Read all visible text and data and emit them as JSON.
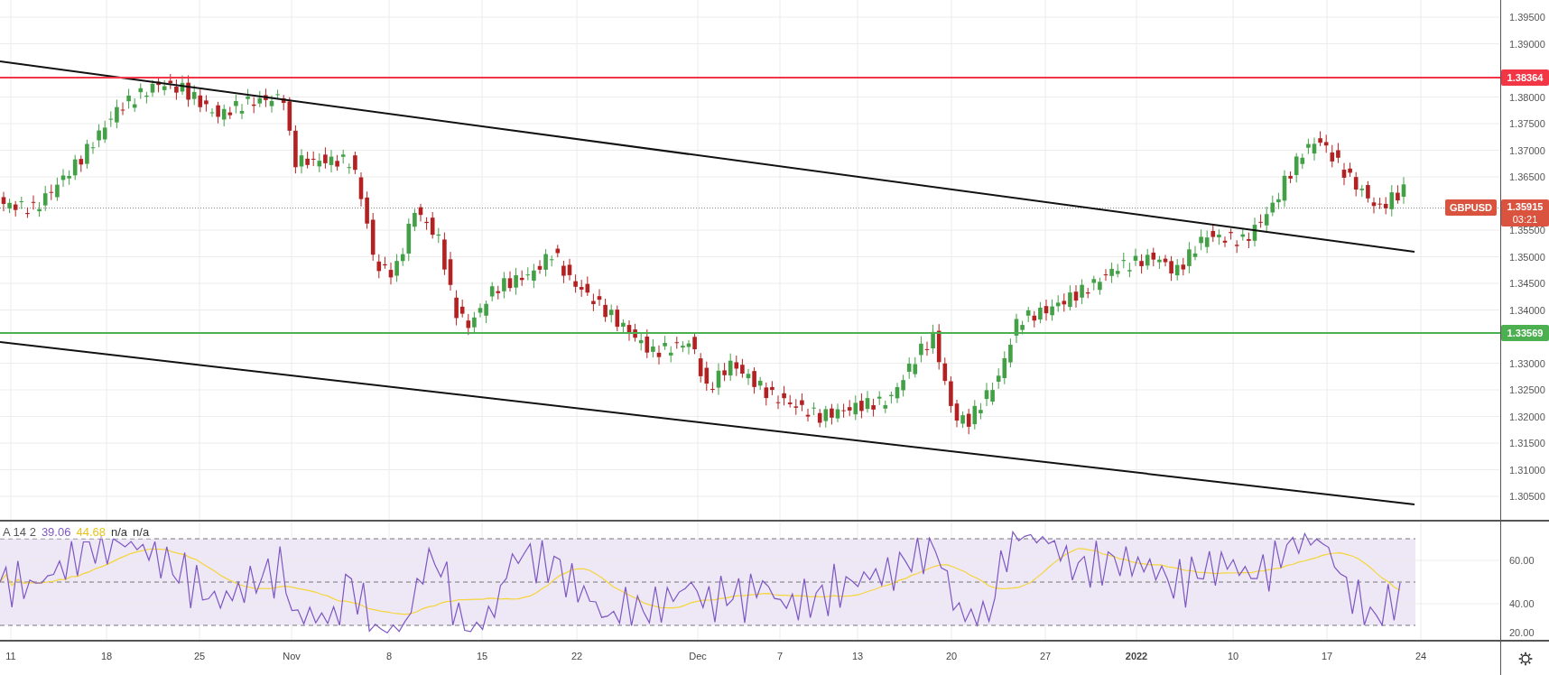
{
  "price_axis": {
    "labels": [
      "1.39500",
      "1.39000",
      "1.38000",
      "1.37500",
      "1.37000",
      "1.36500",
      "1.35500",
      "1.35000",
      "1.34500",
      "1.34000",
      "1.33000",
      "1.32500",
      "1.32000",
      "1.31500",
      "1.31000",
      "1.30500"
    ]
  },
  "levels": [
    {
      "label": "1.38364",
      "color": "#f23645"
    },
    {
      "label": "1.33569",
      "color": "#4caf50"
    }
  ],
  "symbol": {
    "name": "GBPUSD",
    "price": "1.35915",
    "countdown": "03:21"
  },
  "rsi": {
    "legend": {
      "name": "A 14 2",
      "value": "39.06",
      "average": "44.68",
      "value_3": "n/a",
      "value_4": "n/a"
    },
    "axis_labels": [
      "60.00",
      "40.00",
      "20.00"
    ]
  },
  "time_axis": {
    "labels": [
      {
        "text": "11",
        "kind": "day"
      },
      {
        "text": "18",
        "kind": "day"
      },
      {
        "text": "25",
        "kind": "day"
      },
      {
        "text": "Nov",
        "kind": "month"
      },
      {
        "text": "8",
        "kind": "day"
      },
      {
        "text": "15",
        "kind": "day"
      },
      {
        "text": "22",
        "kind": "day"
      },
      {
        "text": "Dec",
        "kind": "month"
      },
      {
        "text": "7",
        "kind": "day"
      },
      {
        "text": "13",
        "kind": "day"
      },
      {
        "text": "20",
        "kind": "day"
      },
      {
        "text": "27",
        "kind": "day"
      },
      {
        "text": "2022",
        "kind": "year"
      },
      {
        "text": "10",
        "kind": "day"
      },
      {
        "text": "17",
        "kind": "day"
      },
      {
        "text": "24",
        "kind": "day"
      }
    ]
  }
}
